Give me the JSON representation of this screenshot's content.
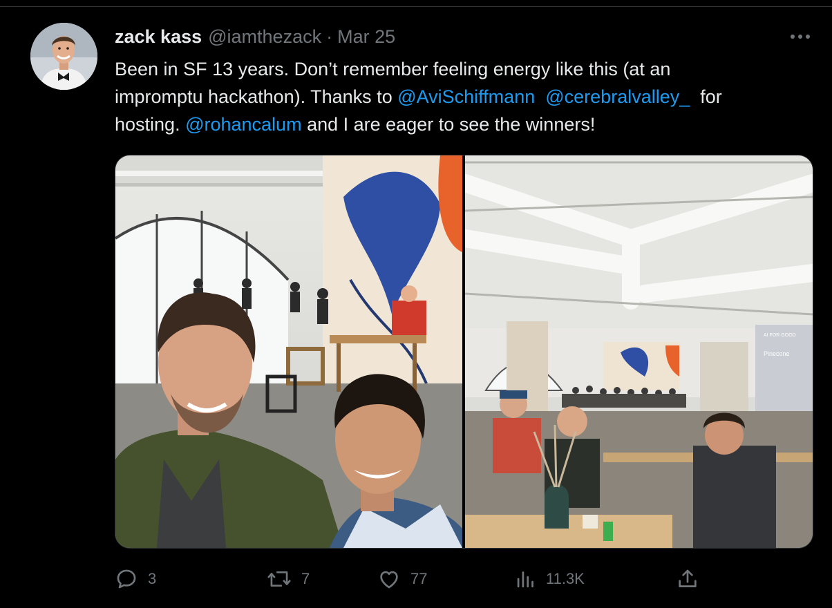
{
  "tweet": {
    "author_name": "zack kass",
    "handle": "@iamthezack",
    "separator": "·",
    "date": "Mar 25",
    "text_lines": [
      {
        "parts": [
          {
            "t": "Been in SF 13 years. Don’t remember feeling energy like this (at an"
          }
        ]
      },
      {
        "parts": [
          {
            "t": "impromptu hackathon). Thanks to "
          },
          {
            "m": "@AviSchiffmann"
          },
          {
            "t": "  "
          },
          {
            "m": "@cerebralvalley_"
          },
          {
            "t": "  for"
          }
        ]
      },
      {
        "parts": [
          {
            "t": "hosting. "
          },
          {
            "m": "@rohancalum"
          },
          {
            "t": " and I are eager to see the winners!"
          }
        ]
      }
    ],
    "mentions": [
      "@AviSchiffmann",
      "@cerebralvalley_",
      "@rohancalum"
    ]
  },
  "media": {
    "photo_1_sign": "AI FOR GOOD",
    "photo_1_sign_brand": "Pinecone"
  },
  "actions": {
    "replies": "3",
    "reposts": "7",
    "likes": "77",
    "views": "11.3K"
  },
  "icons": {
    "reply": "reply-icon",
    "repost": "repost-icon",
    "like": "like-icon",
    "views": "views-icon",
    "share": "share-icon",
    "more": "more-icon"
  },
  "colors": {
    "background": "#000000",
    "text": "#e7e9ea",
    "muted": "#71767b",
    "link": "#1d9bf0",
    "border": "#2f3336"
  }
}
